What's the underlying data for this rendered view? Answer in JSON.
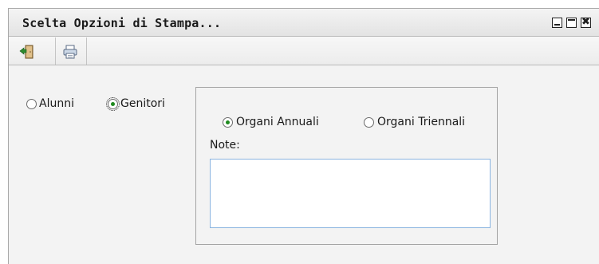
{
  "window": {
    "title": "Scelta Opzioni di Stampa...",
    "controls": {
      "minimize": "minimize",
      "maximize": "maximize",
      "close": "✖"
    }
  },
  "toolbar": {
    "buttons": [
      {
        "icon": "exit-door-icon"
      },
      {
        "icon": "printer-icon"
      }
    ]
  },
  "target_group": {
    "options": [
      {
        "label": "Alunni",
        "checked": false
      },
      {
        "label": "Genitori",
        "checked": true
      }
    ]
  },
  "organi_group": {
    "options": [
      {
        "label": "Organi Annuali",
        "checked": true
      },
      {
        "label": "Organi Triennali",
        "checked": false
      }
    ],
    "note_label": "Note:",
    "note_value": ""
  },
  "colors": {
    "radio_selected": "#1e8a1e",
    "input_border": "#8ab4e0"
  }
}
